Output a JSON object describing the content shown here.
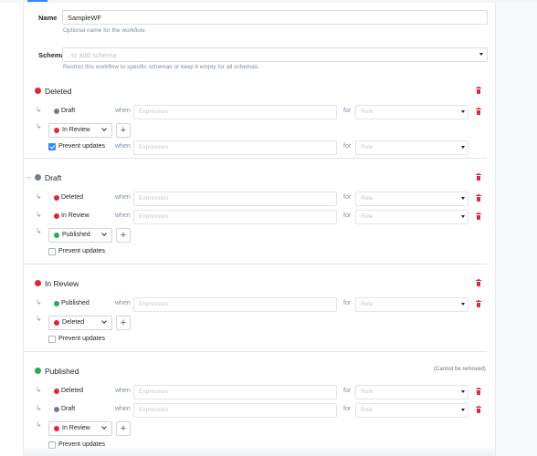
{
  "form": {
    "name_label": "Name",
    "name_value": "SampleWF",
    "name_hint": "Optional name for the workflow.",
    "schemas_label": "Schemas",
    "schemas_placeholder": ", to add schema",
    "schemas_hint": "Restrict this workflow to specific schemas or keep it empty for all schemas."
  },
  "labels": {
    "when": "when",
    "for": "for",
    "expression_placeholder": "Expression",
    "role_placeholder": "Role",
    "prevent_updates": "Prevent updates",
    "add": "+"
  },
  "colors": {
    "deleted": "#e0263b",
    "draft": "#6e7f91",
    "in_review": "#e0263b",
    "published": "#2da84e",
    "accent": "#3389ff"
  },
  "steps": [
    {
      "name": "Deleted",
      "color": "red",
      "is_initial": false,
      "transitions": [
        "Draft"
      ],
      "new_transition_target": "In Review",
      "prevent_updates": true,
      "note": ""
    },
    {
      "name": "Draft",
      "color": "gray",
      "is_initial": true,
      "transitions": [
        "Deleted",
        "In Review"
      ],
      "new_transition_target": "Published",
      "prevent_updates": false,
      "note": ""
    },
    {
      "name": "In Review",
      "color": "red",
      "is_initial": false,
      "transitions": [
        "Published"
      ],
      "new_transition_target": "Deleted",
      "prevent_updates": false,
      "note": ""
    },
    {
      "name": "Published",
      "color": "green",
      "is_initial": false,
      "transitions": [
        "Deleted",
        "Draft"
      ],
      "new_transition_target": "In Review",
      "prevent_updates": false,
      "note": "(Cannot be removed)"
    }
  ],
  "icons": {
    "trash": "trash-icon",
    "transition_arrow": "transition-arrow-icon",
    "initial_arrow": "initial-arrow-icon",
    "caret": "caret-down-icon"
  }
}
